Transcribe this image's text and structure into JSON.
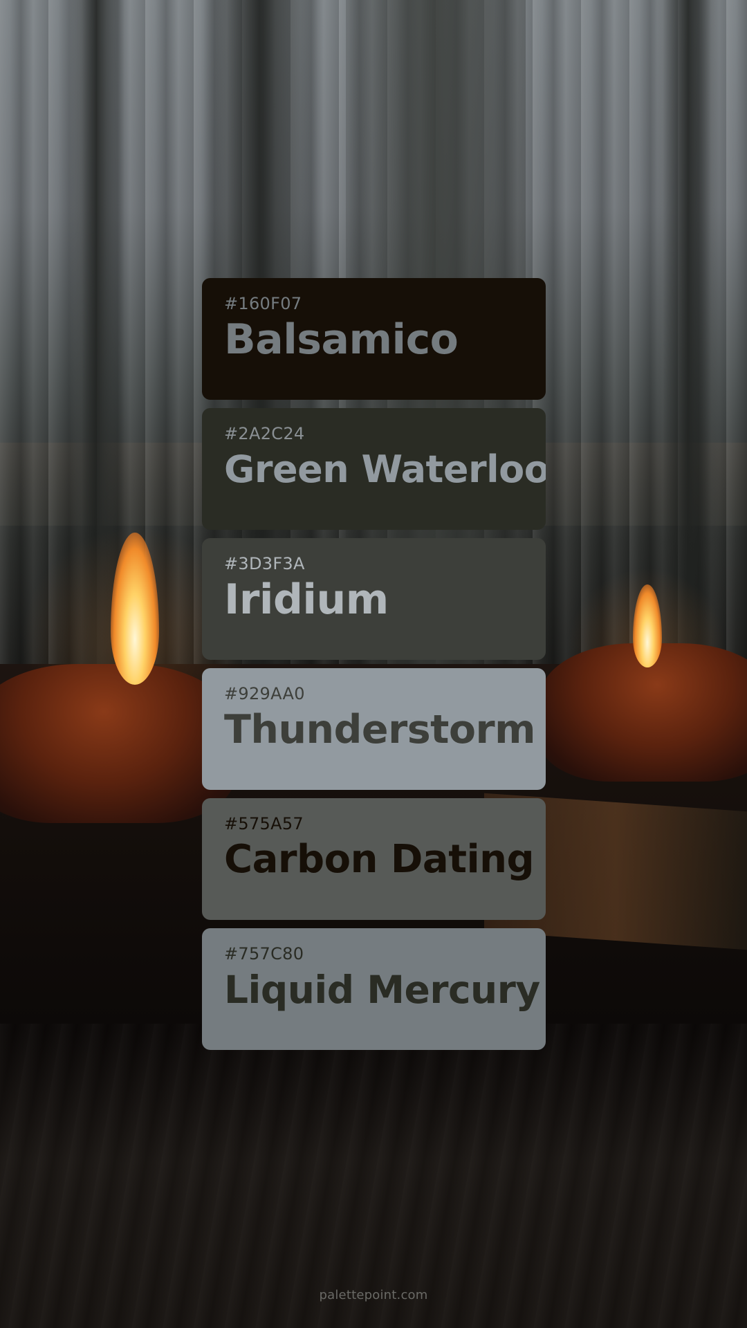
{
  "palette": [
    {
      "hex": "#160F07",
      "name": "Balsamico"
    },
    {
      "hex": "#2A2C24",
      "name": "Green Waterloo"
    },
    {
      "hex": "#3D3F3A",
      "name": "Iridium"
    },
    {
      "hex": "#929AA0",
      "name": "Thunderstorm"
    },
    {
      "hex": "#575A57",
      "name": "Carbon Dating"
    },
    {
      "hex": "#757C80",
      "name": "Liquid Mercury"
    }
  ],
  "footer": {
    "site": "palettepoint.com"
  }
}
